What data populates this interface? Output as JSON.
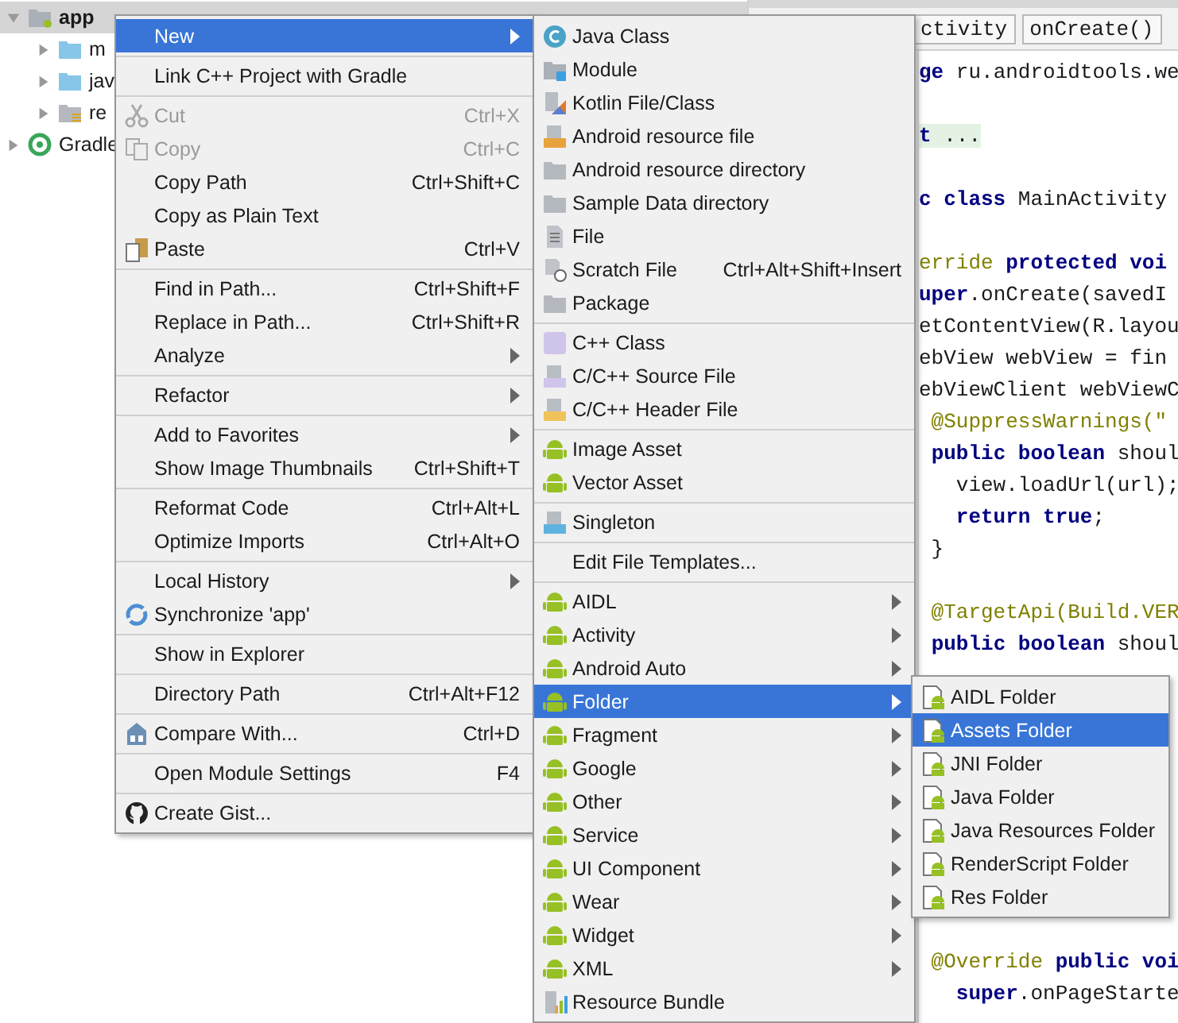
{
  "project_tree": [
    {
      "label": "app",
      "kind": "module",
      "expanded": true,
      "selected": true,
      "children": [
        {
          "label": "m",
          "kind": "folder",
          "expanded": false,
          "selected": false
        },
        {
          "label": "jav",
          "kind": "folder",
          "expanded": false,
          "selected": false
        },
        {
          "label": "re",
          "kind": "res",
          "expanded": false,
          "selected": false
        }
      ]
    },
    {
      "label": "Gradle",
      "kind": "gradle",
      "expanded": false,
      "selected": false
    }
  ],
  "editor": {
    "breadcrumbs": [
      "ctivity",
      "onCreate()"
    ],
    "code_lines": [
      {
        "kind": "code",
        "text": "**ge** ru.androidtools.we"
      },
      {
        "kind": "blank"
      },
      {
        "kind": "folded",
        "text": "**t** ..."
      },
      {
        "kind": "blank"
      },
      {
        "kind": "code",
        "text": "**c class** MainActivity"
      },
      {
        "kind": "blank"
      },
      {
        "kind": "annotation",
        "text": "erride **protected voi**"
      },
      {
        "kind": "code",
        "text": "**uper**.onCreate(savedI"
      },
      {
        "kind": "code",
        "text": "etContentView(R.layou"
      },
      {
        "kind": "code",
        "text": "ebView webView = fin"
      },
      {
        "kind": "code",
        "text": "ebViewClient webViewC"
      },
      {
        "kind": "annotation",
        "text": " @SuppressWarnings(\""
      },
      {
        "kind": "code",
        "text": " **public boolean** shoul"
      },
      {
        "kind": "code",
        "text": "   view.loadUrl(url);"
      },
      {
        "kind": "code",
        "text": "   **return true**;"
      },
      {
        "kind": "code",
        "text": " }"
      },
      {
        "kind": "blank"
      },
      {
        "kind": "annotation",
        "text": " @TargetApi(Build.VER"
      },
      {
        "kind": "code",
        "text": " **public boolean** shoul"
      },
      {
        "kind": "blank"
      },
      {
        "kind": "blank"
      },
      {
        "kind": "blank"
      },
      {
        "kind": "blank"
      },
      {
        "kind": "blank"
      },
      {
        "kind": "blank"
      },
      {
        "kind": "blank"
      },
      {
        "kind": "blank"
      },
      {
        "kind": "blank"
      },
      {
        "kind": "annotation",
        "text": " @Override **public voi**"
      },
      {
        "kind": "code",
        "text": "   **super**.onPageStarte"
      }
    ]
  },
  "context_menu": {
    "groups": [
      [
        {
          "label": "New",
          "kind": "none",
          "submenu": true,
          "disabled": false,
          "selected": true
        }
      ],
      [
        {
          "label": "Link C++ Project with Gradle",
          "kind": "none",
          "submenu": false,
          "disabled": false,
          "selected": false
        }
      ],
      [
        {
          "label": "Cut",
          "kind": "cut",
          "shortcut": "Ctrl+X",
          "submenu": false,
          "disabled": true,
          "selected": false
        },
        {
          "label": "Copy",
          "kind": "copy",
          "shortcut": "Ctrl+C",
          "submenu": false,
          "disabled": true,
          "selected": false
        },
        {
          "label": "Copy Path",
          "kind": "none",
          "shortcut": "Ctrl+Shift+C",
          "submenu": false,
          "disabled": false,
          "selected": false
        },
        {
          "label": "Copy as Plain Text",
          "kind": "none",
          "submenu": false,
          "disabled": false,
          "selected": false
        },
        {
          "label": "Paste",
          "kind": "paste",
          "shortcut": "Ctrl+V",
          "submenu": false,
          "disabled": false,
          "selected": false
        }
      ],
      [
        {
          "label": "Find in Path...",
          "kind": "none",
          "shortcut": "Ctrl+Shift+F",
          "submenu": false,
          "disabled": false,
          "selected": false
        },
        {
          "label": "Replace in Path...",
          "kind": "none",
          "shortcut": "Ctrl+Shift+R",
          "submenu": false,
          "disabled": false,
          "selected": false
        },
        {
          "label": "Analyze",
          "kind": "none",
          "submenu": true,
          "disabled": false,
          "selected": false
        }
      ],
      [
        {
          "label": "Refactor",
          "kind": "none",
          "submenu": true,
          "disabled": false,
          "selected": false
        }
      ],
      [
        {
          "label": "Add to Favorites",
          "kind": "none",
          "submenu": true,
          "disabled": false,
          "selected": false
        },
        {
          "label": "Show Image Thumbnails",
          "kind": "none",
          "shortcut": "Ctrl+Shift+T",
          "submenu": false,
          "disabled": false,
          "selected": false
        }
      ],
      [
        {
          "label": "Reformat Code",
          "kind": "none",
          "shortcut": "Ctrl+Alt+L",
          "submenu": false,
          "disabled": false,
          "selected": false
        },
        {
          "label": "Optimize Imports",
          "kind": "none",
          "shortcut": "Ctrl+Alt+O",
          "submenu": false,
          "disabled": false,
          "selected": false
        }
      ],
      [
        {
          "label": "Local History",
          "kind": "none",
          "submenu": true,
          "disabled": false,
          "selected": false
        },
        {
          "label": "Synchronize 'app'",
          "kind": "sync",
          "submenu": false,
          "disabled": false,
          "selected": false
        }
      ],
      [
        {
          "label": "Show in Explorer",
          "kind": "none",
          "submenu": false,
          "disabled": false,
          "selected": false
        }
      ],
      [
        {
          "label": "Directory Path",
          "kind": "none",
          "shortcut": "Ctrl+Alt+F12",
          "submenu": false,
          "disabled": false,
          "selected": false
        }
      ],
      [
        {
          "label": "Compare With...",
          "kind": "compare",
          "shortcut": "Ctrl+D",
          "submenu": false,
          "disabled": false,
          "selected": false
        }
      ],
      [
        {
          "label": "Open Module Settings",
          "kind": "none",
          "shortcut": "F4",
          "submenu": false,
          "disabled": false,
          "selected": false
        }
      ],
      [
        {
          "label": "Create Gist...",
          "kind": "cat",
          "submenu": false,
          "disabled": false,
          "selected": false
        }
      ]
    ]
  },
  "new_submenu": {
    "groups": [
      [
        {
          "label": "Java Class",
          "kind": "class",
          "submenu": false,
          "disabled": false,
          "selected": false
        },
        {
          "label": "Module",
          "kind": "module",
          "submenu": false,
          "disabled": false,
          "selected": false
        },
        {
          "label": "Kotlin File/Class",
          "kind": "kotlin",
          "submenu": false,
          "disabled": false,
          "selected": false
        },
        {
          "label": "Android resource file",
          "kind": "resource-file",
          "submenu": false,
          "disabled": false,
          "selected": false
        },
        {
          "label": "Android resource directory",
          "kind": "folder",
          "submenu": false,
          "disabled": false,
          "selected": false
        },
        {
          "label": "Sample Data directory",
          "kind": "folder",
          "submenu": false,
          "disabled": false,
          "selected": false
        },
        {
          "label": "File",
          "kind": "file",
          "submenu": false,
          "disabled": false,
          "selected": false
        },
        {
          "label": "Scratch File",
          "kind": "scratch",
          "shortcut": "Ctrl+Alt+Shift+Insert",
          "submenu": false,
          "disabled": false,
          "selected": false
        },
        {
          "label": "Package",
          "kind": "package",
          "submenu": false,
          "disabled": false,
          "selected": false
        }
      ],
      [
        {
          "label": "C++ Class",
          "kind": "cpp-class",
          "submenu": false,
          "disabled": false,
          "selected": false
        },
        {
          "label": "C/C++ Source File",
          "kind": "cpp-source",
          "submenu": false,
          "disabled": false,
          "selected": false
        },
        {
          "label": "C/C++ Header File",
          "kind": "cpp-header",
          "submenu": false,
          "disabled": false,
          "selected": false
        }
      ],
      [
        {
          "label": "Image Asset",
          "kind": "android",
          "submenu": false,
          "disabled": false,
          "selected": false
        },
        {
          "label": "Vector Asset",
          "kind": "android",
          "submenu": false,
          "disabled": false,
          "selected": false
        }
      ],
      [
        {
          "label": "Singleton",
          "kind": "singleton",
          "submenu": false,
          "disabled": false,
          "selected": false
        }
      ],
      [
        {
          "label": "Edit File Templates...",
          "kind": "none",
          "submenu": false,
          "disabled": false,
          "selected": false
        }
      ],
      [
        {
          "label": "AIDL",
          "kind": "android",
          "submenu": true,
          "disabled": false,
          "selected": false
        },
        {
          "label": "Activity",
          "kind": "android",
          "submenu": true,
          "disabled": false,
          "selected": false
        },
        {
          "label": "Android Auto",
          "kind": "android",
          "submenu": true,
          "disabled": false,
          "selected": false
        },
        {
          "label": "Folder",
          "kind": "android",
          "submenu": true,
          "disabled": false,
          "selected": true
        },
        {
          "label": "Fragment",
          "kind": "android",
          "submenu": true,
          "disabled": false,
          "selected": false
        },
        {
          "label": "Google",
          "kind": "android",
          "submenu": true,
          "disabled": false,
          "selected": false
        },
        {
          "label": "Other",
          "kind": "android",
          "submenu": true,
          "disabled": false,
          "selected": false
        },
        {
          "label": "Service",
          "kind": "android",
          "submenu": true,
          "disabled": false,
          "selected": false
        },
        {
          "label": "UI Component",
          "kind": "android",
          "submenu": true,
          "disabled": false,
          "selected": false
        },
        {
          "label": "Wear",
          "kind": "android",
          "submenu": true,
          "disabled": false,
          "selected": false
        },
        {
          "label": "Widget",
          "kind": "android",
          "submenu": true,
          "disabled": false,
          "selected": false
        },
        {
          "label": "XML",
          "kind": "android",
          "submenu": true,
          "disabled": false,
          "selected": false
        },
        {
          "label": "Resource Bundle",
          "kind": "bundle",
          "submenu": false,
          "disabled": false,
          "selected": false
        }
      ]
    ]
  },
  "folder_submenu": {
    "groups": [
      [
        {
          "label": "AIDL Folder",
          "kind": "android-folder",
          "submenu": false,
          "disabled": false,
          "selected": false
        },
        {
          "label": "Assets Folder",
          "kind": "android-folder",
          "submenu": false,
          "disabled": false,
          "selected": true
        },
        {
          "label": "JNI Folder",
          "kind": "android-folder",
          "submenu": false,
          "disabled": false,
          "selected": false
        },
        {
          "label": "Java Folder",
          "kind": "android-folder",
          "submenu": false,
          "disabled": false,
          "selected": false
        },
        {
          "label": "Java Resources Folder",
          "kind": "android-folder",
          "submenu": false,
          "disabled": false,
          "selected": false
        },
        {
          "label": "RenderScript Folder",
          "kind": "android-folder",
          "submenu": false,
          "disabled": false,
          "selected": false
        },
        {
          "label": "Res Folder",
          "kind": "android-folder",
          "submenu": false,
          "disabled": false,
          "selected": false
        }
      ]
    ]
  }
}
